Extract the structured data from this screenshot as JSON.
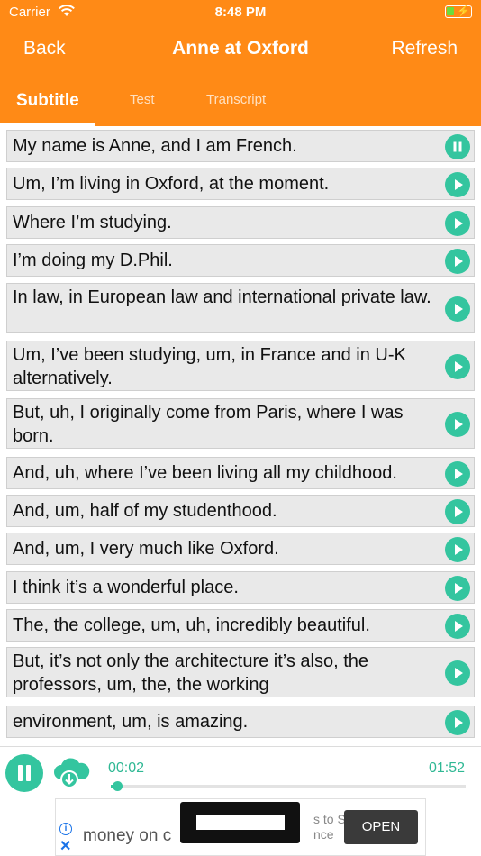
{
  "status_bar": {
    "carrier": "Carrier",
    "time": "8:48 PM",
    "wifi_icon": "wifi-icon",
    "battery_icon": "battery-charging-icon"
  },
  "nav": {
    "back_label": "Back",
    "title": "Anne at Oxford",
    "refresh_label": "Refresh"
  },
  "tabs": [
    {
      "label": "Subtitle",
      "active": true
    },
    {
      "label": "Test",
      "active": false
    },
    {
      "label": "Transcript",
      "active": false
    }
  ],
  "subtitles": [
    {
      "text": "My name is Anne, and I am French.",
      "state": "playing"
    },
    {
      "text": "Um, I’m living in Oxford, at the moment.",
      "state": "idle"
    },
    {
      "text": "Where I’m studying.",
      "state": "idle"
    },
    {
      "text": "I’m doing my D.Phil.",
      "state": "idle"
    },
    {
      "text": "In law, in European law and international private law.",
      "state": "idle"
    },
    {
      "text": "Um, I’ve been studying, um, in France and in U-K alternatively.",
      "state": "idle"
    },
    {
      "text": "But, uh, I originally come from Paris, where I was born.",
      "state": "idle"
    },
    {
      "text": "And, uh, where I’ve been living all my childhood.",
      "state": "idle"
    },
    {
      "text": "And, um, half of my studenthood.",
      "state": "idle"
    },
    {
      "text": "And, um, I very much like Oxford.",
      "state": "idle"
    },
    {
      "text": "I think it’s a wonderful place.",
      "state": "idle"
    },
    {
      "text": "The, the college, um, uh, incredibly beautiful.",
      "state": "idle"
    },
    {
      "text": "But, it’s not only the architecture it’s also, the professors, um, the, the working",
      "state": "idle"
    },
    {
      "text": "environment, um, is amazing.",
      "state": "idle"
    }
  ],
  "player": {
    "current_time": "00:02",
    "total_time": "01:52",
    "progress": 0.018,
    "pause_icon": "pause-icon",
    "download_icon": "cloud-download-icon"
  },
  "ad": {
    "text": "money on c",
    "subtext_line1": "s to Sa",
    "subtext_line2": "nce",
    "cta": "OPEN"
  },
  "colors": {
    "accent_orange": "#ff8a16",
    "accent_green": "#34c59f",
    "row_bg": "#e9e9e9"
  }
}
